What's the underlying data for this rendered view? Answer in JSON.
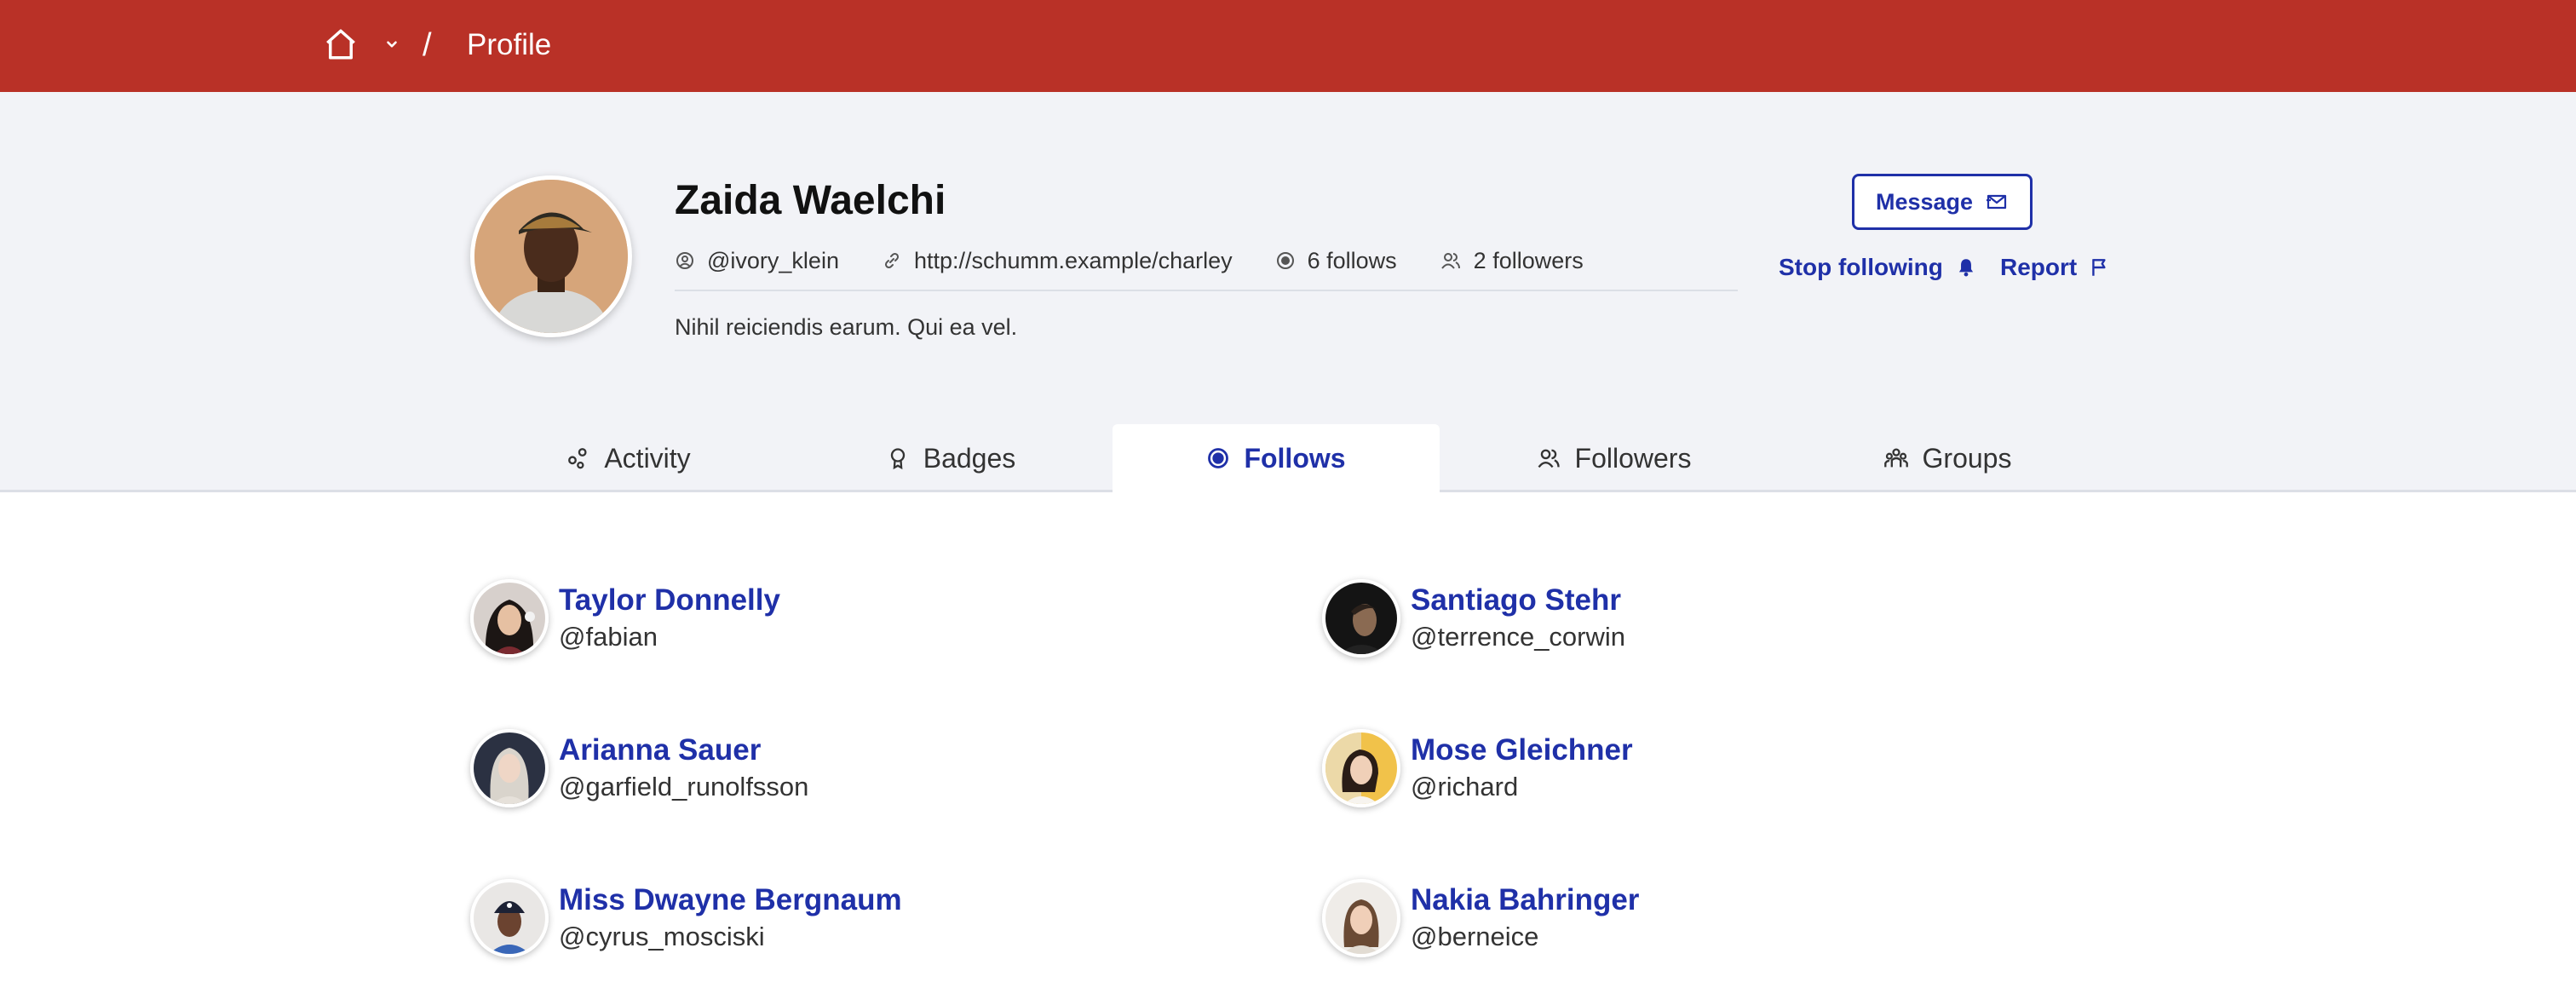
{
  "breadcrumb": {
    "separator": "/",
    "current": "Profile"
  },
  "profile": {
    "name": "Zaida Waelchi",
    "handle": "@ivory_klein",
    "website": "http://schumm.example/charley",
    "follows": "6 follows",
    "followers": "2 followers",
    "bio": "Nihil reiciendis earum. Qui ea vel."
  },
  "actions": {
    "message": "Message",
    "stop_following": "Stop following",
    "report": "Report"
  },
  "tabs": [
    {
      "label": "Activity",
      "icon": "activity-icon"
    },
    {
      "label": "Badges",
      "icon": "badge-icon"
    },
    {
      "label": "Follows",
      "icon": "follows-icon",
      "active": true
    },
    {
      "label": "Followers",
      "icon": "followers-icon"
    },
    {
      "label": "Groups",
      "icon": "groups-icon"
    }
  ],
  "users": [
    {
      "name": "Taylor Donnelly",
      "handle": "@fabian"
    },
    {
      "name": "Santiago Stehr",
      "handle": "@terrence_corwin"
    },
    {
      "name": "Arianna Sauer",
      "handle": "@garfield_runolfsson"
    },
    {
      "name": "Mose Gleichner",
      "handle": "@richard"
    },
    {
      "name": "Miss Dwayne Bergnaum",
      "handle": "@cyrus_mosciski"
    },
    {
      "name": "Nakia Bahringer",
      "handle": "@berneice"
    }
  ],
  "colors": {
    "topbar": "#b93127",
    "accent": "#1f30a8",
    "header_bg": "#f2f3f7"
  }
}
